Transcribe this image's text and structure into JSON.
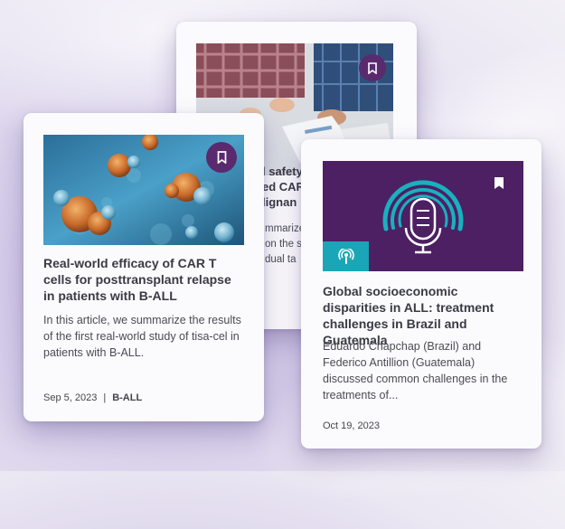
{
  "back_card": {
    "title_lines": [
      "l safety",
      "ed CAR",
      "lignan"
    ],
    "desc_lines": [
      "mmarize t",
      "on the s",
      "dual ta"
    ],
    "bookmark_icon": "bookmark-icon"
  },
  "card_left": {
    "title": "Real-world efficacy of CAR T cells for posttransplant relapse in patients with B-ALL",
    "description": "In this article, we summarize the results of the first real-world study of tisa-cel in patients with B-ALL.",
    "date": "Sep 5, 2023",
    "separator": "|",
    "tag": "B-ALL",
    "bookmark_icon": "bookmark-icon"
  },
  "card_right": {
    "title": "Global socioeconomic disparities in ALL: treatment challenges in Brazil and Guatemala",
    "description": "Eduardo Chapchap (Brazil) and Federico Antillion (Guatemala) discussed common challenges in the treatments of...",
    "date": "Oct 19, 2023",
    "bookmark_icon": "bookmark-icon",
    "media_icon": "microphone-icon",
    "badge_icon": "podcast-icon",
    "colors": {
      "media_bg": "#4d1f63",
      "badge_bg": "#1aa6b7",
      "accent": "#19b0bf"
    }
  }
}
